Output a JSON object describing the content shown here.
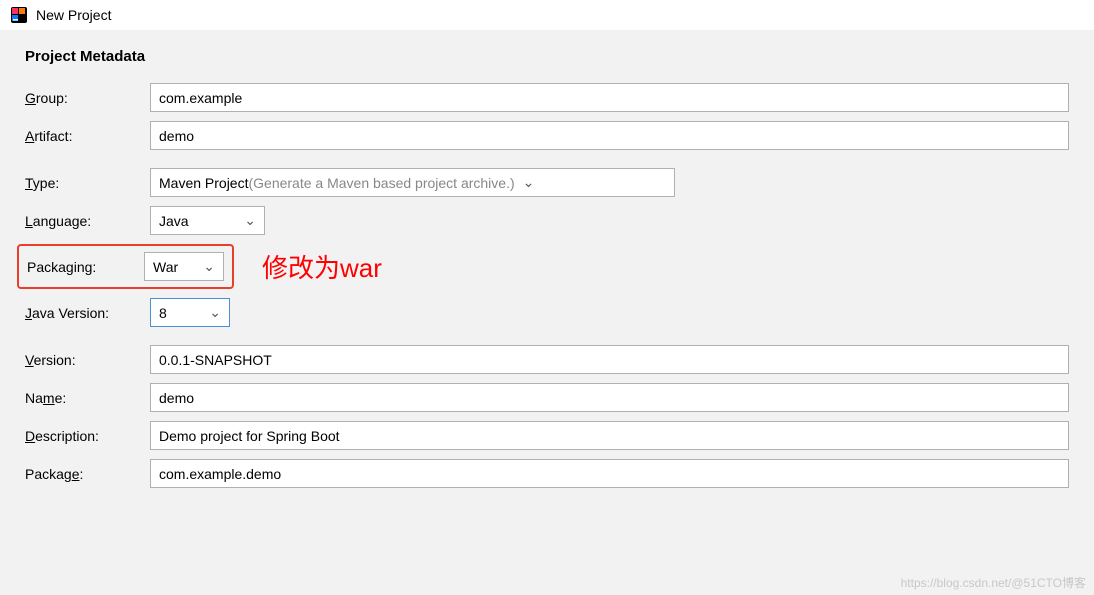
{
  "window": {
    "title": "New Project"
  },
  "section": {
    "title": "Project Metadata"
  },
  "labels": {
    "group_mnemonic": "G",
    "group_rest": "roup:",
    "artifact_mnemonic": "A",
    "artifact_rest": "rtifact:",
    "type_mnemonic": "T",
    "type_rest": "ype:",
    "language_mnemonic": "L",
    "language_rest": "anguage:",
    "packaging_pre": "Packa",
    "packaging_mnemonic": "g",
    "packaging_rest": "ing:",
    "javaversion_mnemonic": "J",
    "javaversion_rest": "ava Version:",
    "version_mnemonic": "V",
    "version_rest": "ersion:",
    "name_pre": "Na",
    "name_mnemonic": "m",
    "name_rest": "e:",
    "description_mnemonic": "D",
    "description_rest": "escription:",
    "package_pre": "Packag",
    "package_mnemonic": "e",
    "package_rest": ":"
  },
  "fields": {
    "group": "com.example",
    "artifact": "demo",
    "type_value": "Maven Project",
    "type_hint": " (Generate a Maven based project archive.)",
    "language": "Java",
    "packaging": "War",
    "java_version": "8",
    "version": "0.0.1-SNAPSHOT",
    "name": "demo",
    "description": "Demo project for Spring Boot",
    "package": "com.example.demo"
  },
  "annotation": "修改为war",
  "watermark": "https://blog.csdn.net/@51CTO博客"
}
